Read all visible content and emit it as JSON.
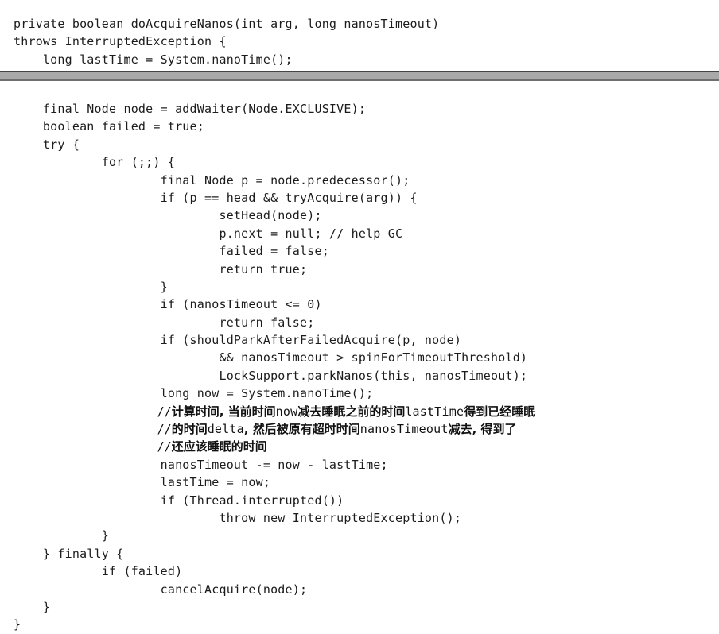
{
  "document": {
    "kind": "code-listing",
    "language": "java",
    "method": "doAcquireNanos"
  },
  "top_block": {
    "lines": [
      "private boolean doAcquireNanos(int arg, long nanosTimeout)",
      "throws InterruptedException {",
      "    long lastTime = System.nanoTime();"
    ]
  },
  "separator": {
    "colors": {
      "dark": "#454545",
      "band": "#a9a9a9",
      "light": "#6f6f6f"
    }
  },
  "main_block": {
    "lines": [
      {
        "type": "code",
        "text": "    final Node node = addWaiter(Node.EXCLUSIVE);"
      },
      {
        "type": "code",
        "text": "    boolean failed = true;"
      },
      {
        "type": "code",
        "text": "    try {"
      },
      {
        "type": "code",
        "text": "            for (;;) {"
      },
      {
        "type": "code",
        "text": "                    final Node p = node.predecessor();"
      },
      {
        "type": "code",
        "text": "                    if (p == head && tryAcquire(arg)) {"
      },
      {
        "type": "code",
        "text": "                            setHead(node);"
      },
      {
        "type": "code",
        "text": "                            p.next = null; // help GC"
      },
      {
        "type": "code",
        "text": "                            failed = false;"
      },
      {
        "type": "code",
        "text": "                            return true;"
      },
      {
        "type": "code",
        "text": "                    }"
      },
      {
        "type": "code",
        "text": "                    if (nanosTimeout <= 0)"
      },
      {
        "type": "code",
        "text": "                            return false;"
      },
      {
        "type": "code",
        "text": "                    if (shouldParkAfterFailedAcquire(p, node)"
      },
      {
        "type": "code",
        "text": "                            && nanosTimeout > spinForTimeoutThreshold)"
      },
      {
        "type": "code",
        "text": "                            LockSupport.parkNanos(this, nanosTimeout);"
      },
      {
        "type": "code",
        "text": "                    long now = System.nanoTime();"
      },
      {
        "type": "comment-cjk",
        "indent": "                    ",
        "parts": [
          {
            "style": "slashes",
            "text": "//"
          },
          {
            "style": "cjk",
            "text": "计算时间, 当前时间"
          },
          {
            "style": "mono",
            "text": "now"
          },
          {
            "style": "cjk",
            "text": "减去睡眠之前的时间"
          },
          {
            "style": "mono",
            "text": "lastTime"
          },
          {
            "style": "cjk",
            "text": "得到已经睡眠"
          }
        ]
      },
      {
        "type": "comment-cjk",
        "indent": "                    ",
        "parts": [
          {
            "style": "slashes",
            "text": "//"
          },
          {
            "style": "cjk",
            "text": "的时间"
          },
          {
            "style": "mono",
            "text": "delta"
          },
          {
            "style": "cjk",
            "text": ", 然后被原有超时时间"
          },
          {
            "style": "mono",
            "text": "nanosTimeout"
          },
          {
            "style": "cjk",
            "text": "减去, 得到了"
          }
        ]
      },
      {
        "type": "comment-cjk",
        "indent": "                    ",
        "parts": [
          {
            "style": "slashes",
            "text": "//"
          },
          {
            "style": "cjk",
            "text": "还应该睡眠的时间"
          }
        ]
      },
      {
        "type": "code",
        "text": "                    nanosTimeout -= now - lastTime;"
      },
      {
        "type": "code",
        "text": "                    lastTime = now;"
      },
      {
        "type": "code",
        "text": "                    if (Thread.interrupted())"
      },
      {
        "type": "code",
        "text": "                            throw new InterruptedException();"
      },
      {
        "type": "code",
        "text": "            }"
      },
      {
        "type": "code",
        "text": "    } finally {"
      },
      {
        "type": "code",
        "text": "            if (failed)"
      },
      {
        "type": "code",
        "text": "                    cancelAcquire(node);"
      },
      {
        "type": "code",
        "text": "    }"
      },
      {
        "type": "code",
        "text": "}"
      }
    ]
  }
}
